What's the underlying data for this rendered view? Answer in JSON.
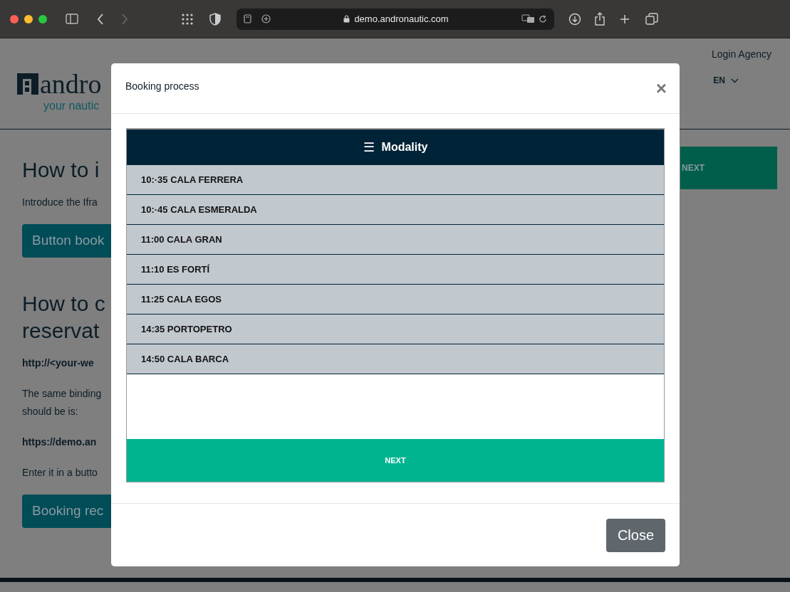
{
  "browser": {
    "url": "demo.andronautic.com"
  },
  "page": {
    "login_link": "Login Agency",
    "logo_text": "andro",
    "logo_tagline": "your nautic",
    "language": "EN",
    "next_button": "NEXT",
    "content": [
      {
        "kind": "heading",
        "text": "How to i"
      },
      {
        "kind": "text",
        "text": "Introduce the Ifra"
      },
      {
        "kind": "button",
        "text": "Button book"
      },
      {
        "kind": "heading",
        "text": "How to c\nreservat"
      },
      {
        "kind": "bold",
        "text": "http://<your-we"
      },
      {
        "kind": "text",
        "text": "The same binding\nshould be is:"
      },
      {
        "kind": "bold",
        "text": "https://demo.an"
      },
      {
        "kind": "text",
        "text": "Enter it in a butto"
      },
      {
        "kind": "button",
        "text": "Booking rec"
      }
    ]
  },
  "modal": {
    "title": "Booking process",
    "close_icon": "×",
    "header": {
      "icon": "☰",
      "title": "Modality"
    },
    "options": [
      "10:·35 CALA FERRERA",
      "10:·45 CALA ESMERALDA",
      "11:00 CALA GRAN",
      "11:10 ES FORTÍ",
      "11:25 CALA EGOS",
      "14:35 PORTOPETRO",
      "14:50 CALA BARCA"
    ],
    "next_button": "NEXT",
    "close_button": "Close"
  }
}
